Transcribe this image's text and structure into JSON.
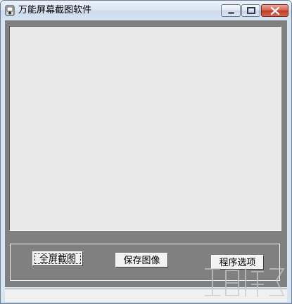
{
  "window": {
    "title": "万能屏幕截图软件",
    "icon": "camera-app-icon",
    "controls": {
      "minimize_icon": "minimize-icon",
      "maximize_icon": "maximize-icon",
      "close_icon": "close-icon"
    }
  },
  "buttons": {
    "full_screen_capture": "全屏截图",
    "save_image": "保存图像",
    "program_options": "程序选项"
  },
  "colors": {
    "client_background": "#808080",
    "canvas_background": "#e9e9e9",
    "close_button": "#c13a25"
  }
}
